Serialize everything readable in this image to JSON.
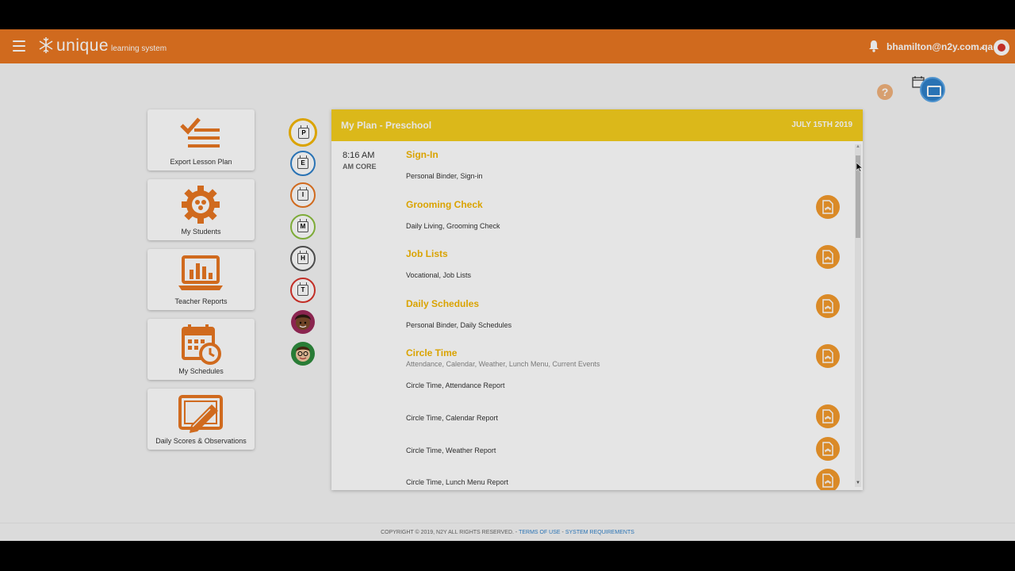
{
  "header": {
    "logo_text": "unique",
    "logo_subtext": "learning system",
    "user_email": "bhamilton@n2y.com.qa",
    "caret": "⌄"
  },
  "help": {
    "label": "?"
  },
  "tiles": [
    {
      "label": "Export Lesson Plan",
      "icon": "checklist-icon"
    },
    {
      "label": "My Students",
      "icon": "gear-students-icon"
    },
    {
      "label": "Teacher Reports",
      "icon": "laptop-chart-icon"
    },
    {
      "label": "My Schedules",
      "icon": "calendar-clock-icon"
    },
    {
      "label": "Daily Scores & Observations",
      "icon": "tablet-pencil-icon"
    }
  ],
  "levels": [
    {
      "letter": "P",
      "color": "#f3b600"
    },
    {
      "letter": "E",
      "color": "#2f80c9"
    },
    {
      "letter": "I",
      "color": "#e87722"
    },
    {
      "letter": "M",
      "color": "#8cbf3f"
    },
    {
      "letter": "H",
      "color": "#555555"
    },
    {
      "letter": "T",
      "color": "#d9342b"
    }
  ],
  "plan": {
    "title": "My Plan - Preschool",
    "date": "JULY 15TH 2019",
    "time": "8:16 AM",
    "block": "AM CORE",
    "sections": [
      {
        "title": "Sign-In",
        "subtitle": "",
        "activities": [
          "Personal Binder, Sign-in"
        ]
      },
      {
        "title": "Grooming Check",
        "subtitle": "",
        "activities": [
          "Daily Living, Grooming Check"
        ]
      },
      {
        "title": "Job Lists",
        "subtitle": "",
        "activities": [
          "Vocational, Job Lists"
        ]
      },
      {
        "title": "Daily Schedules",
        "subtitle": "",
        "activities": [
          "Personal Binder, Daily Schedules"
        ]
      },
      {
        "title": "Circle Time",
        "subtitle": "Attendance, Calendar, Weather, Lunch Menu, Current Events",
        "activities": [
          "Circle Time, Attendance Report",
          "Circle Time, Calendar Report",
          "Circle Time, Weather Report",
          "Circle Time, Lunch Menu Report"
        ]
      }
    ]
  },
  "footer": {
    "copyright": "COPYRIGHT © 2019, N2Y ALL RIGHTS RESERVED. - ",
    "terms": "TERMS OF USE",
    "separator": " - ",
    "requirements": "SYSTEM REQUIREMENTS"
  },
  "colors": {
    "brand_orange": "#e87722",
    "plan_yellow": "#f4cd1d",
    "section_gold": "#f3b600",
    "pdf_orange": "#f39a2c",
    "accent_blue": "#2f80c9"
  }
}
